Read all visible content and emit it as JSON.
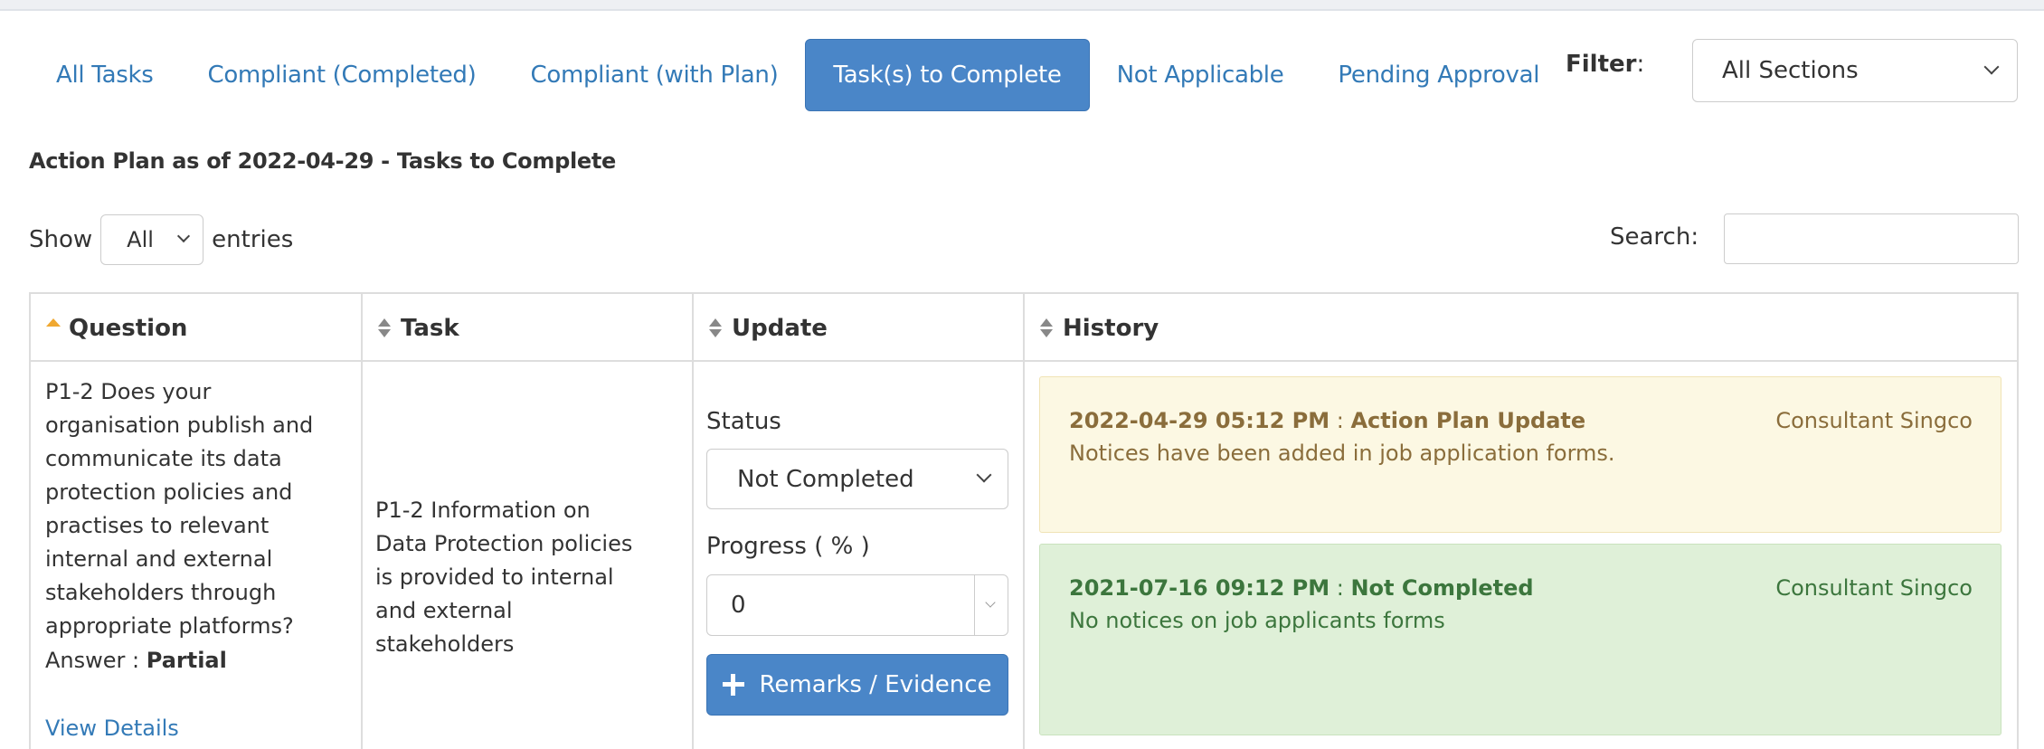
{
  "tabs": [
    {
      "label": "All Tasks"
    },
    {
      "label": "Compliant (Completed)"
    },
    {
      "label": "Compliant (with Plan)"
    },
    {
      "label": "Task(s) to Complete"
    },
    {
      "label": "Not Applicable"
    },
    {
      "label": "Pending Approval"
    }
  ],
  "active_tab": "Task(s) to Complete",
  "filter": {
    "label": "Filter",
    "colon": ":",
    "value": "All Sections"
  },
  "heading": "Action Plan as of 2022-04-29 - Tasks to Complete",
  "length_menu": {
    "show": "Show",
    "value": "All",
    "entries": "entries"
  },
  "search": {
    "label": "Search:",
    "value": ""
  },
  "table": {
    "columns": [
      "Question",
      "Task",
      "Update",
      "History"
    ],
    "rows": [
      {
        "question": "P1-2 Does your organisation publish and communicate its data protection policies and practises to relevant internal and external stakeholders through appropriate platforms?",
        "answer_label": "Answer :",
        "answer_value": "Partial",
        "view_details": "View Details",
        "task": "P1-2 Information on Data Protection policies is provided to internal and external stakeholders",
        "update": {
          "status_label": "Status",
          "status_value": "Not Completed",
          "progress_label": "Progress ( % )",
          "progress_value": "0",
          "button_label": "Remarks / Evidence"
        },
        "history": [
          {
            "datetime": "2022-04-29 05:12 PM",
            "sep": ":",
            "action": "Action Plan Update",
            "note": "Notices have been added in job application forms.",
            "user": "Consultant Singco",
            "style": "warning"
          },
          {
            "datetime": "2021-07-16 09:12 PM",
            "sep": ":",
            "action": "Not Completed",
            "note": "No notices on job applicants forms",
            "user": "Consultant Singco",
            "style": "success"
          }
        ]
      }
    ]
  },
  "colors": {
    "link": "#337ab7",
    "active_tab": "#4a86c8",
    "sort_active": "#f0a830",
    "history_warning": "#fcf8e3",
    "history_success": "#dff0d8"
  },
  "icons": {
    "sort": "sort-both-icon",
    "sort_asc": "sort-asc-icon",
    "dropdown": "chevron-down-icon",
    "add": "plus-icon"
  }
}
